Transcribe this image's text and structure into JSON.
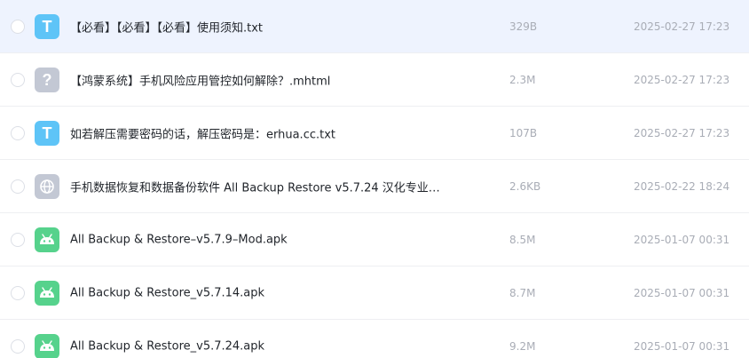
{
  "files": [
    {
      "name": "【必看】【必看】【必看】使用须知.txt",
      "size": "329B",
      "date": "2025-02-27 17:23",
      "icon": "txt-file-icon",
      "icon_glyph": "T",
      "highlighted": true
    },
    {
      "name": "【鸿蒙系统】手机风险应用管控如何解除？.mhtml",
      "size": "2.3M",
      "date": "2025-02-27 17:23",
      "icon": "unknown-file-icon",
      "icon_glyph": "?"
    },
    {
      "name": "如若解压需要密码的话，解压密码是：erhua.cc.txt",
      "size": "107B",
      "date": "2025-02-27 17:23",
      "icon": "txt-file-icon",
      "icon_glyph": "T"
    },
    {
      "name": "手机数据恢复和数据备份软件 All Backup Restore v5.7.24 汉化专业…",
      "size": "2.6KB",
      "date": "2025-02-22 18:24",
      "icon": "web-link-icon",
      "icon_glyph": ""
    },
    {
      "name": "All Backup & Restore–v5.7.9–Mod.apk",
      "size": "8.5M",
      "date": "2025-01-07 00:31",
      "icon": "android-apk-icon",
      "icon_glyph": ""
    },
    {
      "name": "All Backup & Restore_v5.7.14.apk",
      "size": "8.7M",
      "date": "2025-01-07 00:31",
      "icon": "android-apk-icon",
      "icon_glyph": ""
    },
    {
      "name": "All Backup & Restore_v5.7.24.apk",
      "size": "9.2M",
      "date": "2025-01-07 00:31",
      "icon": "android-apk-icon",
      "icon_glyph": ""
    }
  ],
  "colors": {
    "highlight_row": "#eef3fe",
    "txt_icon": "#5ec4f7",
    "unknown_icon": "#c3c8d4",
    "apk_icon": "#56d28c",
    "meta_text": "#a9adb6",
    "name_text": "#1f2329"
  }
}
